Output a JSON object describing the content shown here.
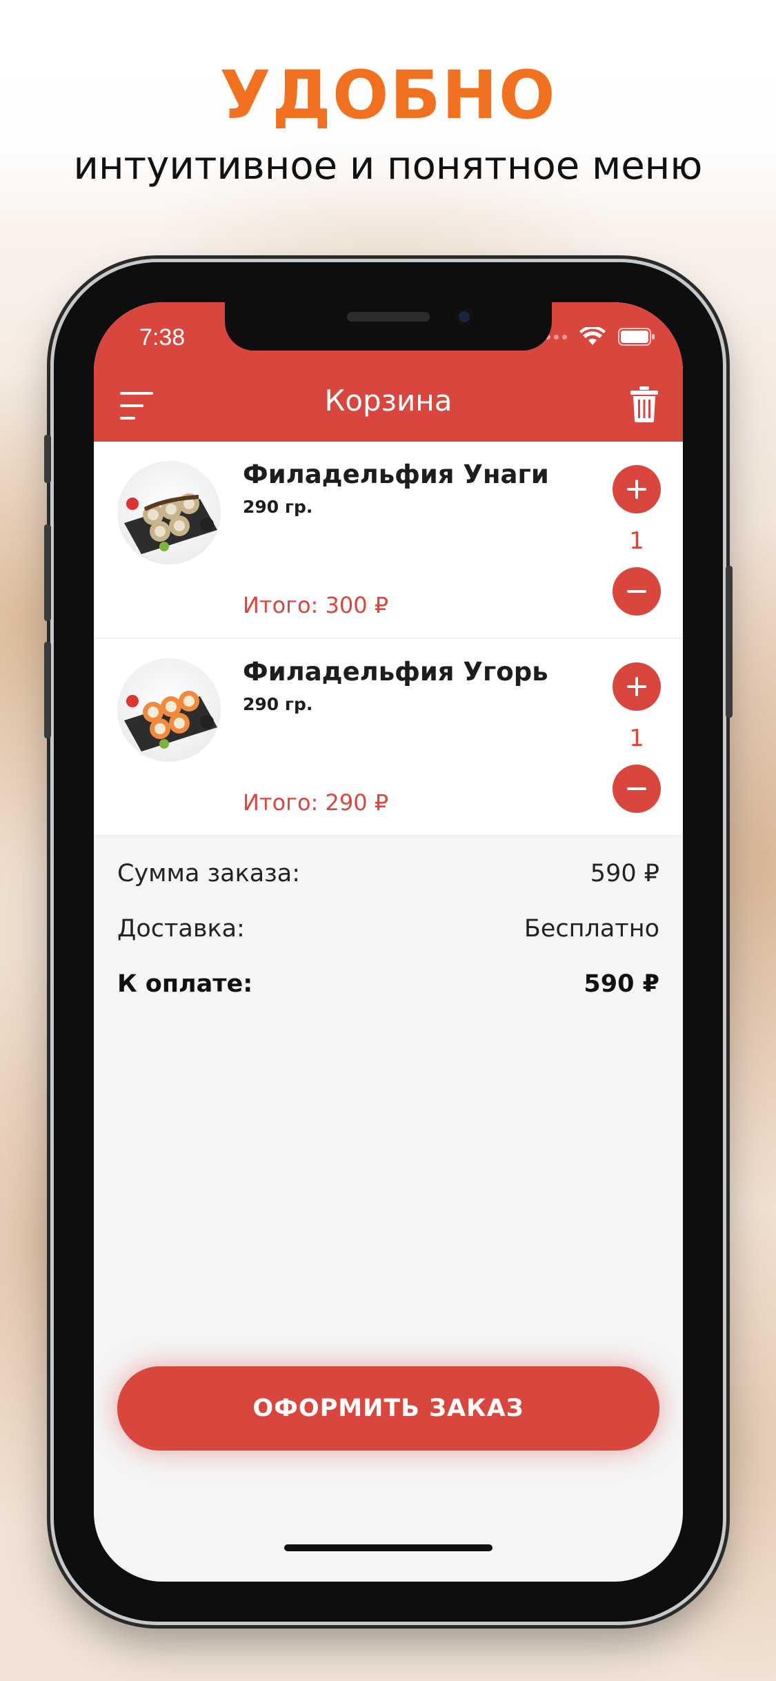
{
  "promo": {
    "headline": "УДОБНО",
    "subline": "интуитивное и понятное меню"
  },
  "status_bar": {
    "time": "7:38"
  },
  "header": {
    "title": "Корзина",
    "menu_icon": "menu-icon",
    "trash_icon": "trash-icon"
  },
  "cart": {
    "items": [
      {
        "name": "Филадельфия Унаги",
        "weight": "290 гр.",
        "quantity": "1",
        "total": "Итого: 300 ₽"
      },
      {
        "name": "Филадельфия Угорь",
        "weight": "290 гр.",
        "quantity": "1",
        "total": "Итого: 290 ₽"
      }
    ]
  },
  "summary": {
    "subtotal_label": "Сумма заказа:",
    "subtotal_value": "590 ₽",
    "delivery_label": "Доставка:",
    "delivery_value": "Бесплатно",
    "pay_label": "К оплате:",
    "pay_value": "590 ₽"
  },
  "checkout_button": "ОФОРМИТЬ ЗАКАЗ",
  "colors": {
    "accent": "#d9463d",
    "headline": "#f27121"
  }
}
